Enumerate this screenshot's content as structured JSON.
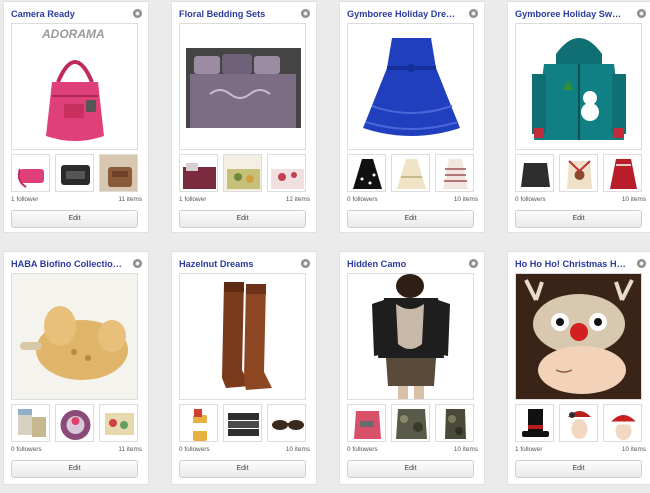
{
  "boards": [
    {
      "title": "Camera Ready",
      "followers": "1 follower",
      "items": "11 items",
      "edit": "Edit",
      "watermark": "ADORAMA"
    },
    {
      "title": "Floral Bedding Sets",
      "followers": "1 follower",
      "items": "12 items",
      "edit": "Edit"
    },
    {
      "title": "Gymboree Holiday Dre…",
      "followers": "0 followers",
      "items": "10 items",
      "edit": "Edit"
    },
    {
      "title": "Gymboree Holiday Sw…",
      "followers": "0 followers",
      "items": "10 items",
      "edit": "Edit"
    },
    {
      "title": "HABA Biofino Collectio…",
      "followers": "0 followers",
      "items": "11 items",
      "edit": "Edit"
    },
    {
      "title": "Hazelnut Dreams",
      "followers": "0 followers",
      "items": "10 items",
      "edit": "Edit"
    },
    {
      "title": "Hidden Camo",
      "followers": "0 followers",
      "items": "10 items",
      "edit": "Edit"
    },
    {
      "title": "Ho Ho Ho! Christmas H…",
      "followers": "1 follower",
      "items": "10 items",
      "edit": "Edit"
    }
  ],
  "colors": {
    "title": "#2b3b9e",
    "page_bg": "#ebebeb",
    "card_bg": "#ffffff"
  },
  "icons": {
    "board_settings": "gear-icon"
  }
}
